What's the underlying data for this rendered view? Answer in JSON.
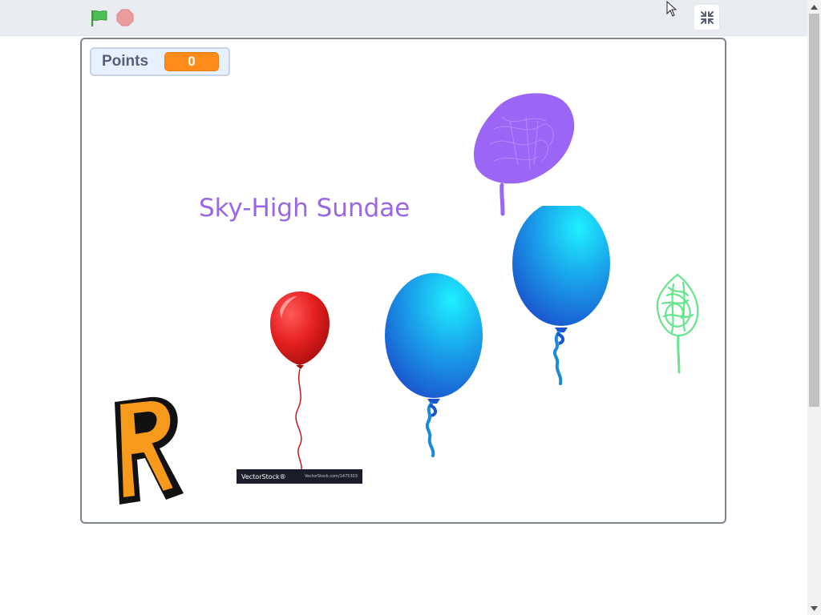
{
  "toolbar": {
    "green_flag_icon": "green-flag-icon",
    "stop_icon": "stop-sign-icon",
    "unfullscreen_icon": "exit-fullscreen-icon"
  },
  "monitor": {
    "label": "Points",
    "value": "0"
  },
  "stage": {
    "title_text": "Sky-High Sundae",
    "watermark_left": "VectorStock®",
    "watermark_right": "VectorStock.com/1475303"
  },
  "colors": {
    "flag": "#4cbf56",
    "stop": "#ec9c9c",
    "monitor_value_bg": "#ff8c1a",
    "title": "#9966e6",
    "balloon_red": "#e62020",
    "balloon_blue": "#1a9be6",
    "scribble_purple": "#9b66f5",
    "scribble_green": "#66e68c",
    "letter_r": "#f79a1c"
  },
  "sprites": {
    "red_balloon": "red-balloon-icon",
    "blue_balloon_1": "blue-balloon-icon",
    "blue_balloon_2": "blue-balloon-icon",
    "purple_scribble": "purple-scribble-balloon",
    "green_scribble": "green-scribble-balloon",
    "letter_r": "letter-r-sprite"
  }
}
